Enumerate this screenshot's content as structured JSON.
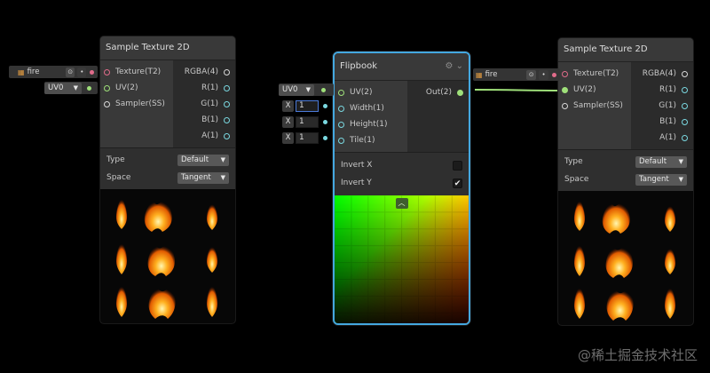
{
  "node_left": {
    "title": "Sample Texture 2D",
    "inputs": [
      "Texture(T2)",
      "UV(2)",
      "Sampler(SS)"
    ],
    "outputs": [
      "RGBA(4)",
      "R(1)",
      "G(1)",
      "B(1)",
      "A(1)"
    ],
    "type_label": "Type",
    "type_value": "Default",
    "space_label": "Space",
    "space_value": "Tangent"
  },
  "node_right": {
    "title": "Sample Texture 2D",
    "inputs": [
      "Texture(T2)",
      "UV(2)",
      "Sampler(SS)"
    ],
    "outputs": [
      "RGBA(4)",
      "R(1)",
      "G(1)",
      "B(1)",
      "A(1)"
    ],
    "type_label": "Type",
    "type_value": "Default",
    "space_label": "Space",
    "space_value": "Tangent"
  },
  "left_texture_field": {
    "value": "fire"
  },
  "right_texture_field": {
    "value": "fire"
  },
  "left_uv_dropdown": {
    "value": "UV0"
  },
  "flipbook": {
    "title": "Flipbook",
    "uv_dropdown": "UV0",
    "inputs": [
      "UV(2)",
      "Width(1)",
      "Height(1)",
      "Tile(1)"
    ],
    "output": "Out(2)",
    "fields": [
      {
        "label": "X",
        "value": "1"
      },
      {
        "label": "X",
        "value": "1"
      },
      {
        "label": "X",
        "value": "1"
      }
    ],
    "invert_x_label": "Invert X",
    "invert_x": false,
    "invert_y_label": "Invert Y",
    "invert_y": true,
    "icons": {
      "settings": "gear-icon",
      "collapse": "chevron-down-icon",
      "preview_toggle": "chevron-up-icon"
    }
  },
  "watermark": "@稀土掘金技术社区"
}
